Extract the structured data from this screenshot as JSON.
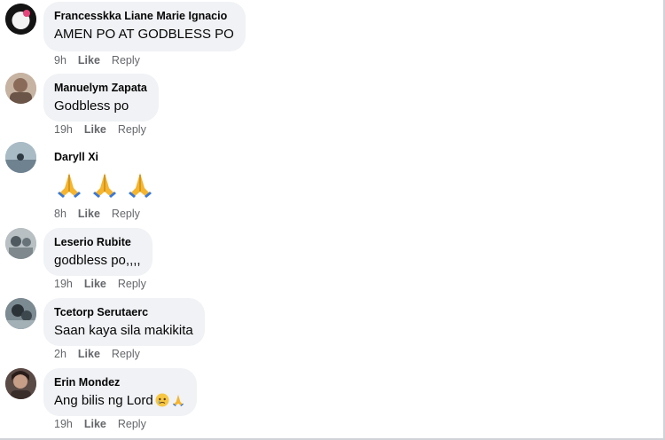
{
  "comments": [
    {
      "author": "Francesskka Liane Marie Ignacio",
      "text": "AMEN PO AT GODBLESS PO",
      "time": "9h",
      "like": "Like",
      "reply": "Reply"
    },
    {
      "author": "Manuelym Zapata",
      "text": "Godbless po",
      "time": "19h",
      "like": "Like",
      "reply": "Reply"
    },
    {
      "author": "Daryll Xi",
      "text": "",
      "emojis": [
        "folded-hands",
        "folded-hands",
        "folded-hands"
      ],
      "time": "8h",
      "like": "Like",
      "reply": "Reply"
    },
    {
      "author": "Leserio Rubite",
      "text": "godbless po,,,,",
      "time": "19h",
      "like": "Like",
      "reply": "Reply"
    },
    {
      "author": "Tcetorp Serutaerc",
      "text": "Saan kaya sila makikita",
      "time": "2h",
      "like": "Like",
      "reply": "Reply"
    },
    {
      "author": "Erin Mondez",
      "text": "Ang bilis ng Lord",
      "emojis": [
        "crying-face",
        "folded-hands"
      ],
      "time": "19h",
      "like": "Like",
      "reply": "Reply"
    }
  ]
}
